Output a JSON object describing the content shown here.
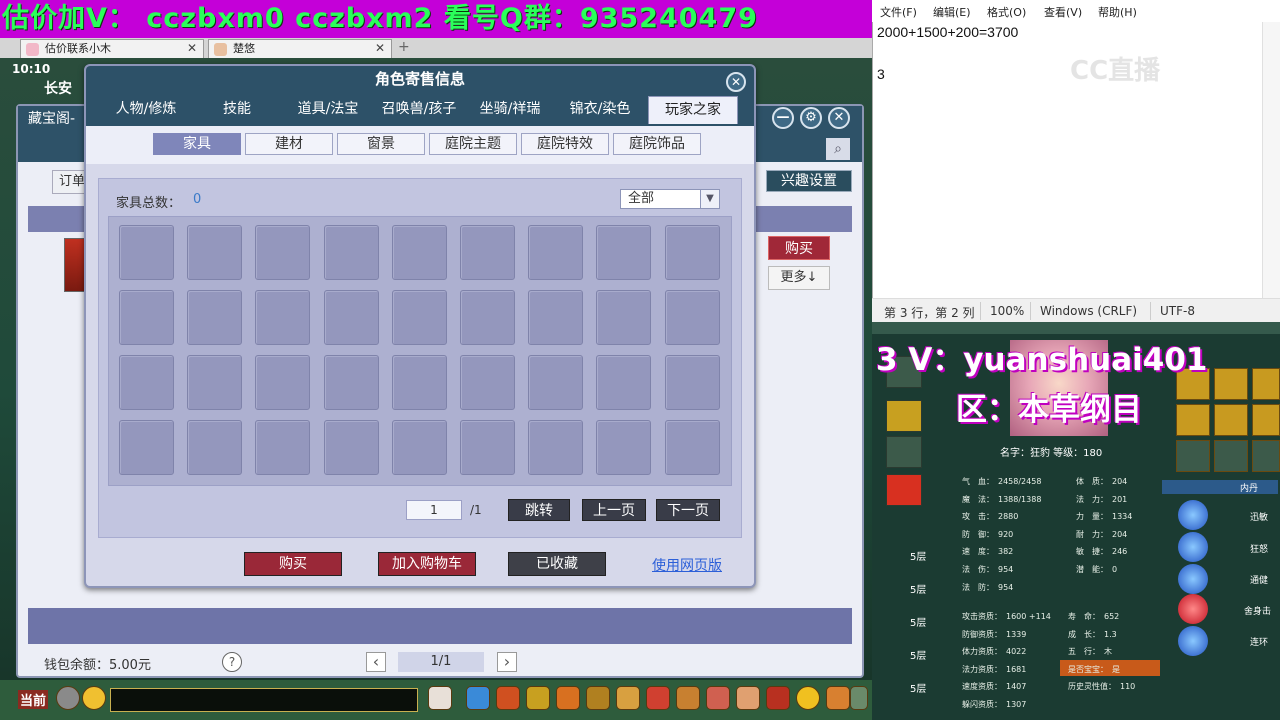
{
  "banner": {
    "text": "估价加V： cczbxm0   cczbxm2   看号Q群：935240479"
  },
  "browser_tabs": [
    {
      "label": "估价联系小木"
    },
    {
      "label": "楚悠"
    }
  ],
  "game": {
    "time": "10:10",
    "location": "长安"
  },
  "treasure_window": {
    "title": "藏宝阁-",
    "interest_label": "兴趣设置",
    "order_label": "订单",
    "buy_label": "购买",
    "more_label": "更多↓",
    "wallet_label": "钱包余额：5.00元",
    "help_label": "?",
    "pagination": "1/1"
  },
  "dialog": {
    "title": "角色寄售信息",
    "main_tabs": [
      "人物/修炼",
      "技能",
      "道具/法宝",
      "召唤兽/孩子",
      "坐骑/祥瑞",
      "锦衣/染色",
      "玩家之家"
    ],
    "active_main_tab": "玩家之家",
    "sub_tabs": [
      "家具",
      "建材",
      "窗景",
      "庭院主题",
      "庭院特效",
      "庭院饰品"
    ],
    "active_sub_tab": "家具",
    "count_label": "家具总数：",
    "count_value": "0",
    "filter_value": "全部",
    "page_current": "1",
    "page_total": "/1",
    "jump_label": "跳转",
    "prev_label": "上一页",
    "next_label": "下一页",
    "buy_label": "购买",
    "add_cart_label": "加入购物车",
    "favorited_label": "已收藏",
    "web_label": "使用网页版"
  },
  "bottom_bar": {
    "current_tab": "当前"
  },
  "notepad": {
    "menu": [
      "文件(F)",
      "编辑(E)",
      "格式(O)",
      "查看(V)",
      "帮助(H)"
    ],
    "line1": "2000+1500+200=3700",
    "line2": "3",
    "watermark": "CC直播",
    "status": [
      "第 3 行，第 2 列",
      "100%",
      "Windows (CRLF)",
      "UTF-8"
    ]
  },
  "stream_overlay": {
    "title": "3   V：yuanshuai401",
    "zone": "区：本草纲目"
  },
  "pet_panel": {
    "name_level": "名字：狂豹  等级：180",
    "stats_left": [
      {
        "k": "气　血：",
        "v": "2458/2458"
      },
      {
        "k": "魔　法：",
        "v": "1388/1388"
      },
      {
        "k": "攻　击：",
        "v": "2880"
      },
      {
        "k": "防　御：",
        "v": "920"
      },
      {
        "k": "速　度：",
        "v": "382"
      },
      {
        "k": "法　伤：",
        "v": "954"
      },
      {
        "k": "法　防：",
        "v": "954"
      }
    ],
    "stats_right": [
      {
        "k": "体　质：",
        "v": "204"
      },
      {
        "k": "法　力：",
        "v": "201"
      },
      {
        "k": "力　量：",
        "v": "1334"
      },
      {
        "k": "耐　力：",
        "v": "204"
      },
      {
        "k": "敏　捷：",
        "v": "246"
      },
      {
        "k": "潜　能：",
        "v": "0"
      }
    ],
    "aptitudes_left": [
      {
        "k": "攻击资质：",
        "v": "1600 +114"
      },
      {
        "k": "防御资质：",
        "v": "1339"
      },
      {
        "k": "体力资质：",
        "v": "4022"
      },
      {
        "k": "法力资质：",
        "v": "1681"
      },
      {
        "k": "速度资质：",
        "v": "1407"
      },
      {
        "k": "躲闪资质：",
        "v": "1307"
      }
    ],
    "aptitudes_right": [
      {
        "k": "寿　命：",
        "v": "652"
      },
      {
        "k": "成　长：",
        "v": "1.3"
      },
      {
        "k": "五　行：",
        "v": "木"
      },
      {
        "k": "是否宝宝：",
        "v": "是"
      },
      {
        "k": "历史灵性值：",
        "v": "110"
      }
    ],
    "layers": [
      "5层",
      "5层",
      "5层",
      "5层",
      "5层"
    ],
    "neidan_title": "内丹",
    "skills": [
      "迅敏",
      "狂怒",
      "通健",
      "舍身击",
      "连环"
    ]
  }
}
